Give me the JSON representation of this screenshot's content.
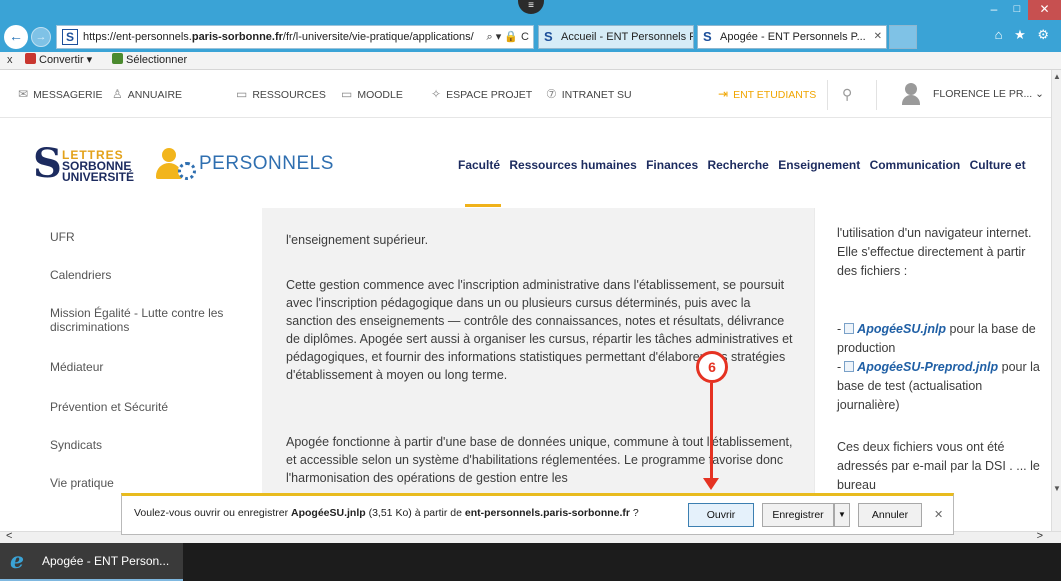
{
  "browser": {
    "url_prefix": "https://ent-personnels.",
    "url_domain": "paris-sorbonne.fr",
    "url_rest": "/fr/l-universite/vie-pratique/applications/",
    "url_controls": "⌕ ▾ 🔒 C",
    "tabs": [
      {
        "label": "Accueil - ENT Personnels Paris ..."
      },
      {
        "label": "Apogée - ENT Personnels P..."
      }
    ],
    "right_icons": "⌂ ★ ⚙",
    "command_bar": {
      "close": "x",
      "convert": "Convertir ▾",
      "select": "Sélectionner"
    }
  },
  "topnav": {
    "items": [
      "MESSAGERIE",
      "ANNUAIRE",
      "RESSOURCES",
      "MOODLE",
      "ESPACE PROJET",
      "INTRANET SU"
    ],
    "ent_etudiants": "ENT ETUDIANTS",
    "user": "FLORENCE LE PR..."
  },
  "brand": {
    "logo_line1": "LETTRES",
    "logo_line2": "SORBONNE",
    "logo_line3": "UNIVERSITÉ",
    "name": "PERSONNELS"
  },
  "mainmenu": [
    "Faculté",
    "Ressources humaines",
    "Finances",
    "Recherche",
    "Enseignement",
    "Communication",
    "Culture et"
  ],
  "sidebar": [
    "UFR",
    "Calendriers",
    "Mission Égalité - Lutte contre les discriminations",
    "Médiateur",
    "Prévention et Sécurité",
    "Syndicats",
    "Vie pratique"
  ],
  "content": {
    "p0": "l'enseignement supérieur.",
    "p1": "Cette gestion commence avec l'inscription administrative dans l'établissement, se poursuit avec l'inscription pédagogique dans un ou plusieurs cursus déterminés, puis avec la sanction des enseignements — contrôle des connaissances, notes et résultats, délivrance de diplômes. Apogée sert aussi à organiser les cursus, répartir les tâches administratives et pédagogiques, et fournir des informations statistiques permettant d'élaborer des stratégies d'établissement à moyen ou long terme.",
    "p2": "Apogée fonctionne à partir d'une base de données unique, commune à tout l'établissement, et accessible selon un système d'habilitations réglementées. Le programme favorise donc l'harmonisation des opérations de gestion entre les"
  },
  "rightcol": {
    "intro": "l'utilisation d'un navigateur internet. Elle s'effectue directement à partir des fichiers :",
    "file1": "ApogéeSU.jnlp",
    "file1_desc": " pour la base de production",
    "file2": "ApogéeSU-Preprod.jnlp",
    "file2_desc": " pour la base de test (actualisation journalière)",
    "outro": "Ces deux fichiers vous ont été adressés par e-mail par la DSI . ... le bureau"
  },
  "download_bar": {
    "msg_start": "Voulez-vous ouvrir ou enregistrer ",
    "file": "ApogéeSU.jnlp",
    "size": " (3,51 Ko) à partir de ",
    "host": "ent-personnels.paris-sorbonne.fr",
    "msg_end": " ?",
    "open": "Ouvrir",
    "save": "Enregistrer",
    "cancel": "Annuler"
  },
  "annotation": {
    "step": "6",
    "color": "#e53222"
  },
  "taskbar": {
    "app": "Apogée - ENT Person..."
  },
  "colors": {
    "chrome": "#3aa3d6",
    "accent": "#f0b21a",
    "navy": "#1c2b5f"
  }
}
